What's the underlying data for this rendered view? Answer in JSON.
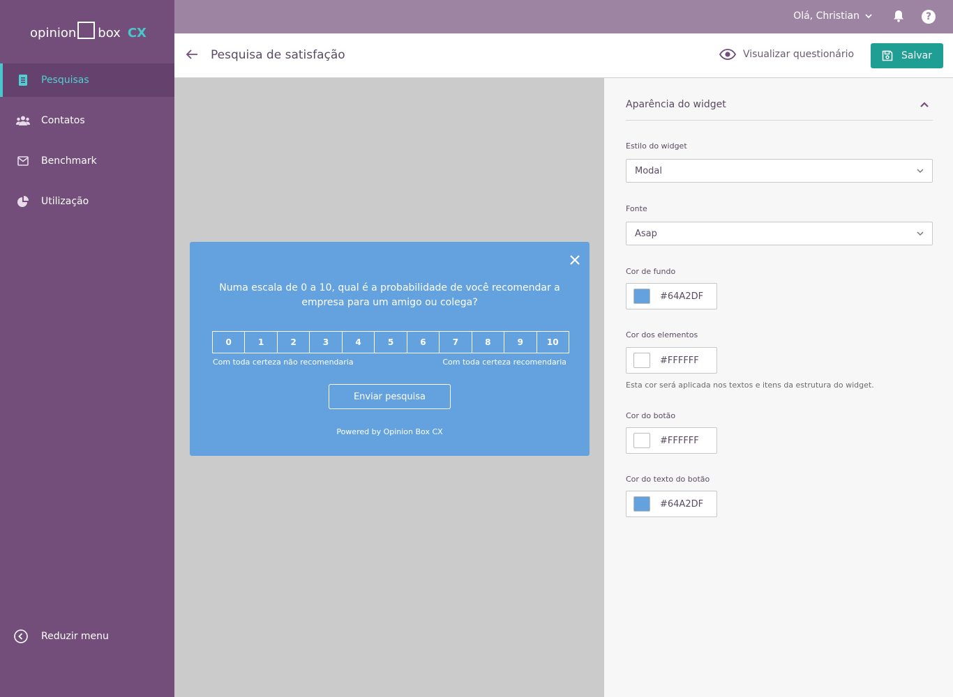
{
  "brand": {
    "word1": "opinion",
    "word2": "box",
    "suffix": "CX",
    "accent": "#49c8cc"
  },
  "sidebar": {
    "items": [
      {
        "label": "Pesquisas",
        "icon": "document-icon",
        "active": true
      },
      {
        "label": "Contatos",
        "icon": "users-icon",
        "active": false
      },
      {
        "label": "Benchmark",
        "icon": "mail-icon",
        "active": false
      },
      {
        "label": "Utilização",
        "icon": "pie-chart-icon",
        "active": false
      }
    ],
    "reduce_label": "Reduzir menu"
  },
  "topbar": {
    "greeting": "Olá, Christian",
    "help_label": "?"
  },
  "header": {
    "title": "Pesquisa de satisfação",
    "preview_label": "Visualizar questionário",
    "save_label": "Salvar",
    "save_color": "#1f9e94"
  },
  "widget": {
    "background": "#64A2DF",
    "question": "Numa escala de 0 a 10, qual é a probabilidade de você recomendar a empresa para um amigo ou colega?",
    "scale": [
      "0",
      "1",
      "2",
      "3",
      "4",
      "5",
      "6",
      "7",
      "8",
      "9",
      "10"
    ],
    "label_low": "Com toda certeza não recomendaria",
    "label_high": "Com toda certeza recomendaria",
    "submit_label": "Enviar pesquisa",
    "powered_by": "Powered by Opinion Box CX"
  },
  "panel": {
    "section_title": "Aparência do widget",
    "style_label": "Estilo do widget",
    "style_value": "Modal",
    "font_label": "Fonte",
    "font_value": "Asap",
    "bg_color_label": "Cor de fundo",
    "bg_color_value": "#64A2DF",
    "elements_color_label": "Cor dos elementos",
    "elements_color_value": "#FFFFFF",
    "elements_hint": "Esta cor será aplicada nos textos e itens da estrutura do widget.",
    "button_color_label": "Cor do botão",
    "button_color_value": "#FFFFFF",
    "button_text_color_label": "Cor do texto do botão",
    "button_text_color_value": "#64A2DF"
  }
}
